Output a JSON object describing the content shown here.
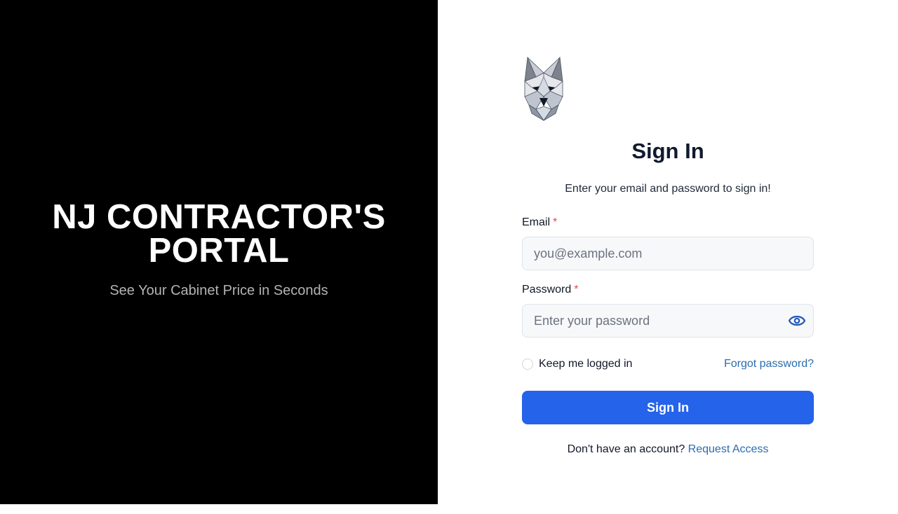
{
  "hero": {
    "title_line1": "NJ CONTRACTOR'S",
    "title_line2": "PORTAL",
    "subtitle": "See Your Cabinet Price in Seconds"
  },
  "form": {
    "logo_icon": "wolf-head-logo-icon",
    "title": "Sign In",
    "subtitle": "Enter your email and password to sign in!",
    "email_label": "Email",
    "email_placeholder": "you@example.com",
    "email_value": "",
    "password_label": "Password",
    "password_placeholder": "Enter your password",
    "password_value": "",
    "required_mark": "*",
    "keep_logged_in": "Keep me logged in",
    "keep_logged_in_checked": false,
    "forgot_password": "Forgot password?",
    "signin_button": "Sign In",
    "no_account_text": "Don't have an account?",
    "request_access": "Request Access"
  },
  "colors": {
    "hero_bg": "#000000",
    "primary_button": "#2563eb",
    "link": "#2b6cb0",
    "required": "#e5484d",
    "title_text": "#111a2e"
  }
}
